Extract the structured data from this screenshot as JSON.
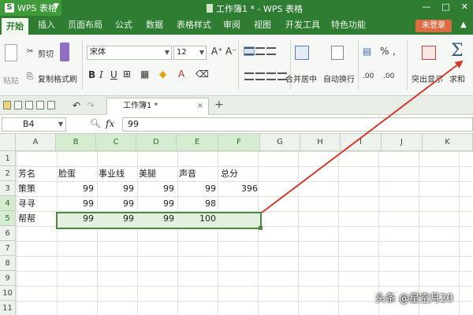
{
  "app": {
    "name": "WPS 表格",
    "doc_title": "工作簿1 * - WPS 表格",
    "window_controls": [
      "—",
      "□",
      "✕"
    ]
  },
  "menu": {
    "items": [
      "开始",
      "插入",
      "页面布局",
      "公式",
      "数据",
      "表格样式",
      "审阅",
      "视图",
      "开发工具",
      "特色功能"
    ],
    "login": "未登录"
  },
  "ribbon": {
    "paste": "粘贴",
    "cut": "剪切",
    "copy": "复制",
    "format_painter": "格式刷",
    "font_name": "宋体",
    "font_size": "12",
    "bold": "B",
    "italic": "I",
    "underline": "U",
    "font_color": "A",
    "merge_center": "合并居中",
    "wrap_text": "自动换行",
    "percent": "%",
    "comma": ",",
    "dec_increase": ".00",
    "dec_decrease": ".00",
    "highlight": "突出显示",
    "sum": "求和",
    "sigma": "Σ"
  },
  "tabs": {
    "doc_tab": "工作簿1 *",
    "close": "×",
    "add": "+"
  },
  "formula_bar": {
    "name_box": "B4",
    "fx": "fx",
    "value": "99"
  },
  "sheet": {
    "columns": [
      "A",
      "B",
      "C",
      "D",
      "E",
      "F",
      "G",
      "H",
      "I",
      "J",
      "K"
    ],
    "rows": [
      "1",
      "2",
      "3",
      "4",
      "5",
      "6",
      "7",
      "8",
      "9",
      "10",
      "11"
    ],
    "selected_range": "B4:F5",
    "cells": {
      "A2": "芳名",
      "B2": "脸蛋",
      "C2": "事业线",
      "D2": "美腿",
      "E2": "声音",
      "F2": "总分",
      "A3": "策策",
      "B3": "99",
      "C3": "99",
      "D3": "99",
      "E3": "99",
      "F3": "396",
      "A4": "寻寻",
      "B4": "99",
      "C4": "99",
      "D4": "99",
      "E4": "98",
      "A5": "帮帮",
      "B5": "99",
      "C5": "99",
      "D5": "99",
      "E5": "100"
    }
  },
  "watermark": "头条 @星空月20",
  "colors": {
    "titlebar": "#2e7d32",
    "selection_fill": "#e3f0df",
    "selection_border": "#4c8a3f",
    "annotation_arrow": "#d23a2e",
    "login_button": "#e06b42"
  }
}
